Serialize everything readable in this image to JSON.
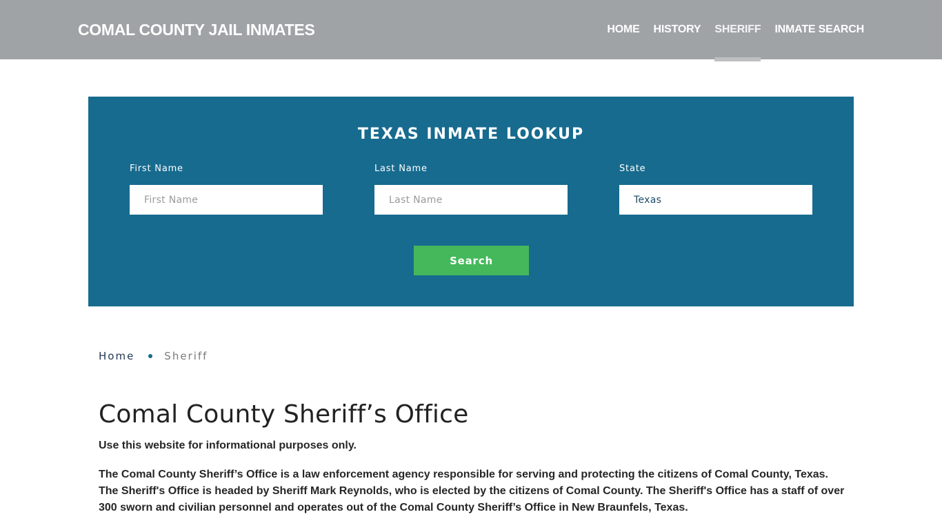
{
  "header": {
    "brand": "COMAL COUNTY JAIL INMATES",
    "nav": [
      {
        "label": "HOME",
        "active": false
      },
      {
        "label": "HISTORY",
        "active": false
      },
      {
        "label": "SHERIFF",
        "active": true
      },
      {
        "label": "INMATE SEARCH",
        "active": false
      }
    ]
  },
  "lookup": {
    "title": "TEXAS INMATE LOOKUP",
    "first_name": {
      "label": "First Name",
      "placeholder": "First Name",
      "value": ""
    },
    "last_name": {
      "label": "Last Name",
      "placeholder": "Last Name",
      "value": ""
    },
    "state": {
      "label": "State",
      "value": "Texas"
    },
    "search_label": "Search",
    "colors": {
      "panel": "#176b8e",
      "button": "#44b85a"
    }
  },
  "breadcrumb": {
    "home": "Home",
    "current": "Sheriff"
  },
  "content": {
    "title": "Comal County Sheriff’s Office",
    "disclaimer": "Use this website for informational purposes only.",
    "intro": "The Comal County Sheriff’s Office is a law enforcement agency responsible for serving and protecting the citizens of Comal County, Texas. The Sheriff's Office is headed by Sheriff Mark Reynolds, who is elected by the citizens of Comal County. The Sheriff's Office has a staff of over 300 sworn and civilian personnel and operates out of the Comal County Sheriff’s Office in New Braunfels, Texas."
  }
}
